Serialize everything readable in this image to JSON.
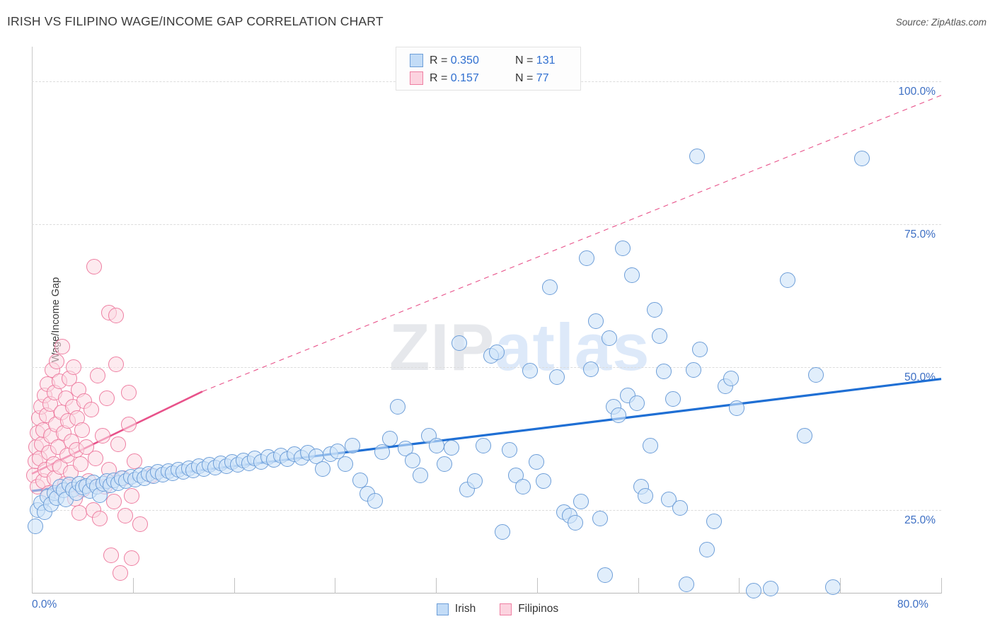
{
  "header": {
    "title": "IRISH VS FILIPINO WAGE/INCOME GAP CORRELATION CHART",
    "source": "Source: ZipAtlas.com"
  },
  "watermark": {
    "zip": "ZIP",
    "atlas": "atlas"
  },
  "stats": {
    "irish": {
      "r_label": "R = ",
      "r_value": "0.350",
      "n_label": "N = ",
      "n_value": "131"
    },
    "filipino": {
      "r_label": "R = ",
      "r_value": "0.157",
      "n_label": "N = ",
      "n_value": "77"
    }
  },
  "legend": {
    "irish_label": "Irish",
    "filipino_label": "Filipinos"
  },
  "chart_data": {
    "type": "scatter",
    "title": "IRISH VS FILIPINO WAGE/INCOME GAP CORRELATION CHART",
    "xlabel": "",
    "ylabel": "Wage/Income Gap",
    "xlim": [
      0,
      80
    ],
    "ylim": [
      10.5,
      106
    ],
    "grid": true,
    "legend_position": "bottom-center",
    "xticks": [
      0.0,
      80.0
    ],
    "xtick_labels": [
      "0.0%",
      "80.0%"
    ],
    "yticks": [
      25.0,
      50.0,
      75.0,
      100.0
    ],
    "ytick_labels": [
      "25.0%",
      "50.0%",
      "75.0%",
      "100.0%"
    ],
    "colors": {
      "irish_fill": "#cee3f8",
      "irish_stroke": "#6d9ed8",
      "filipino_fill": "#fbd8e2",
      "filipino_stroke": "#ee7fa2",
      "irish_trend": "#1f6fd4",
      "filipino_trend": "#e8528a",
      "tick_text": "#3d6fc4"
    },
    "series": [
      {
        "name": "Irish",
        "r": 0.35,
        "n": 131,
        "trend": {
          "style": "solid",
          "x0": 0.0,
          "y0": 28.3,
          "x1": 80.0,
          "y1": 47.9
        },
        "points": [
          [
            0.3,
            22.1
          ],
          [
            0.5,
            25.0
          ],
          [
            0.8,
            26.2
          ],
          [
            1.1,
            24.6
          ],
          [
            1.4,
            27.3
          ],
          [
            1.7,
            26.0
          ],
          [
            2.0,
            28.0
          ],
          [
            2.2,
            27.1
          ],
          [
            2.5,
            29.0
          ],
          [
            2.8,
            28.4
          ],
          [
            3.0,
            26.8
          ],
          [
            3.3,
            29.4
          ],
          [
            3.6,
            28.6
          ],
          [
            3.9,
            27.9
          ],
          [
            4.2,
            29.6
          ],
          [
            4.5,
            28.9
          ],
          [
            4.8,
            29.2
          ],
          [
            5.1,
            28.3
          ],
          [
            5.4,
            29.8
          ],
          [
            5.7,
            29.1
          ],
          [
            6.0,
            27.6
          ],
          [
            6.3,
            29.5
          ],
          [
            6.6,
            30.0
          ],
          [
            6.9,
            29.3
          ],
          [
            7.2,
            30.2
          ],
          [
            7.6,
            29.7
          ],
          [
            7.9,
            30.5
          ],
          [
            8.3,
            30.1
          ],
          [
            8.7,
            30.8
          ],
          [
            9.1,
            30.3
          ],
          [
            9.5,
            31.0
          ],
          [
            9.9,
            30.6
          ],
          [
            10.3,
            31.3
          ],
          [
            10.7,
            30.9
          ],
          [
            11.1,
            31.6
          ],
          [
            11.5,
            31.1
          ],
          [
            12.0,
            31.8
          ],
          [
            12.4,
            31.4
          ],
          [
            12.9,
            32.0
          ],
          [
            13.3,
            31.6
          ],
          [
            13.8,
            32.3
          ],
          [
            14.2,
            31.9
          ],
          [
            14.7,
            32.6
          ],
          [
            15.1,
            32.1
          ],
          [
            15.6,
            32.9
          ],
          [
            16.1,
            32.4
          ],
          [
            16.6,
            33.1
          ],
          [
            17.1,
            32.7
          ],
          [
            17.6,
            33.4
          ],
          [
            18.1,
            32.9
          ],
          [
            18.6,
            33.6
          ],
          [
            19.1,
            33.1
          ],
          [
            19.6,
            34.0
          ],
          [
            20.2,
            33.4
          ],
          [
            20.8,
            34.2
          ],
          [
            21.3,
            33.7
          ],
          [
            21.9,
            34.5
          ],
          [
            22.5,
            33.9
          ],
          [
            23.1,
            34.7
          ],
          [
            23.7,
            34.1
          ],
          [
            24.3,
            35.0
          ],
          [
            25.0,
            34.4
          ],
          [
            25.6,
            32.1
          ],
          [
            26.3,
            34.8
          ],
          [
            26.9,
            35.3
          ],
          [
            27.6,
            33.0
          ],
          [
            28.2,
            36.2
          ],
          [
            28.9,
            30.2
          ],
          [
            29.5,
            27.8
          ],
          [
            30.2,
            26.6
          ],
          [
            30.8,
            35.1
          ],
          [
            31.5,
            37.5
          ],
          [
            32.2,
            43.0
          ],
          [
            32.9,
            35.7
          ],
          [
            33.5,
            33.6
          ],
          [
            34.2,
            31.0
          ],
          [
            34.9,
            38.0
          ],
          [
            35.6,
            36.2
          ],
          [
            36.3,
            33.0
          ],
          [
            36.9,
            35.9
          ],
          [
            37.6,
            54.2
          ],
          [
            38.3,
            28.6
          ],
          [
            39.0,
            30.0
          ],
          [
            39.7,
            36.2
          ],
          [
            40.4,
            52.0
          ],
          [
            40.9,
            52.6
          ],
          [
            41.4,
            21.2
          ],
          [
            42.0,
            35.5
          ],
          [
            42.6,
            31.0
          ],
          [
            43.2,
            29.0
          ],
          [
            43.8,
            49.4
          ],
          [
            44.4,
            33.4
          ],
          [
            45.0,
            30.1
          ],
          [
            45.6,
            64.0
          ],
          [
            46.2,
            48.2
          ],
          [
            46.8,
            24.6
          ],
          [
            47.3,
            24.0
          ],
          [
            47.8,
            22.8
          ],
          [
            48.3,
            26.5
          ],
          [
            48.8,
            69.0
          ],
          [
            49.2,
            49.6
          ],
          [
            49.6,
            58.0
          ],
          [
            50.0,
            23.5
          ],
          [
            50.4,
            13.6
          ],
          [
            50.8,
            55.0
          ],
          [
            51.2,
            43.0
          ],
          [
            51.6,
            41.5
          ],
          [
            52.0,
            70.8
          ],
          [
            52.4,
            45.0
          ],
          [
            52.8,
            66.0
          ],
          [
            53.2,
            43.6
          ],
          [
            53.6,
            29.0
          ],
          [
            54.0,
            27.4
          ],
          [
            54.4,
            36.2
          ],
          [
            54.8,
            60.0
          ],
          [
            55.2,
            55.4
          ],
          [
            55.6,
            49.2
          ],
          [
            56.0,
            26.8
          ],
          [
            56.4,
            44.4
          ],
          [
            57.0,
            25.4
          ],
          [
            57.6,
            12.0
          ],
          [
            58.2,
            49.5
          ],
          [
            58.8,
            53.0
          ],
          [
            59.4,
            18.0
          ],
          [
            60.0,
            23.0
          ],
          [
            61.0,
            46.6
          ],
          [
            61.5,
            48.0
          ],
          [
            62.0,
            42.8
          ],
          [
            63.5,
            10.9
          ],
          [
            65.0,
            11.2
          ],
          [
            66.5,
            65.2
          ],
          [
            68.0,
            38.0
          ],
          [
            69.0,
            48.6
          ],
          [
            70.5,
            11.5
          ],
          [
            73.0,
            86.5
          ],
          [
            58.5,
            86.8
          ]
        ]
      },
      {
        "name": "Filipinos",
        "r": 0.157,
        "n": 77,
        "trend": {
          "style": "solid",
          "x0": 0.0,
          "y0": 31.3,
          "x1": 15.0,
          "y1": 45.7
        },
        "trend_extension": {
          "style": "dashed",
          "x0": 15.0,
          "y0": 45.7,
          "x1": 80.0,
          "y1": 97.5
        },
        "points": [
          [
            0.2,
            31.0
          ],
          [
            0.3,
            33.5
          ],
          [
            0.4,
            36.0
          ],
          [
            0.5,
            38.5
          ],
          [
            0.5,
            29.0
          ],
          [
            0.6,
            41.0
          ],
          [
            0.7,
            34.0
          ],
          [
            0.8,
            43.0
          ],
          [
            0.9,
            36.5
          ],
          [
            1.0,
            30.0
          ],
          [
            1.0,
            39.0
          ],
          [
            1.1,
            45.0
          ],
          [
            1.2,
            32.0
          ],
          [
            1.3,
            41.5
          ],
          [
            1.4,
            47.0
          ],
          [
            1.5,
            35.0
          ],
          [
            1.5,
            28.0
          ],
          [
            1.6,
            43.5
          ],
          [
            1.7,
            38.0
          ],
          [
            1.8,
            49.5
          ],
          [
            1.9,
            33.0
          ],
          [
            2.0,
            45.5
          ],
          [
            2.0,
            30.5
          ],
          [
            2.1,
            40.0
          ],
          [
            2.2,
            51.0
          ],
          [
            2.3,
            36.0
          ],
          [
            2.4,
            47.5
          ],
          [
            2.5,
            32.5
          ],
          [
            2.6,
            42.0
          ],
          [
            2.7,
            53.5
          ],
          [
            2.8,
            38.5
          ],
          [
            2.9,
            29.5
          ],
          [
            3.0,
            44.5
          ],
          [
            3.1,
            34.5
          ],
          [
            3.2,
            40.5
          ],
          [
            3.3,
            48.0
          ],
          [
            3.4,
            31.5
          ],
          [
            3.5,
            37.0
          ],
          [
            3.6,
            43.0
          ],
          [
            3.7,
            50.0
          ],
          [
            3.8,
            27.0
          ],
          [
            3.9,
            35.5
          ],
          [
            4.0,
            41.0
          ],
          [
            4.1,
            46.0
          ],
          [
            4.2,
            24.5
          ],
          [
            4.3,
            33.0
          ],
          [
            4.4,
            39.0
          ],
          [
            4.5,
            28.5
          ],
          [
            4.6,
            44.0
          ],
          [
            4.8,
            36.0
          ],
          [
            5.0,
            30.0
          ],
          [
            5.2,
            42.5
          ],
          [
            5.4,
            25.0
          ],
          [
            5.6,
            34.0
          ],
          [
            5.8,
            48.5
          ],
          [
            6.0,
            23.5
          ],
          [
            6.2,
            38.0
          ],
          [
            6.4,
            29.0
          ],
          [
            6.6,
            44.5
          ],
          [
            6.8,
            32.0
          ],
          [
            7.0,
            17.0
          ],
          [
            7.2,
            26.5
          ],
          [
            7.4,
            50.5
          ],
          [
            7.6,
            36.5
          ],
          [
            7.8,
            14.0
          ],
          [
            8.0,
            30.5
          ],
          [
            8.2,
            24.0
          ],
          [
            8.5,
            40.0
          ],
          [
            8.8,
            27.5
          ],
          [
            9.0,
            33.5
          ],
          [
            9.5,
            22.5
          ],
          [
            5.5,
            67.5
          ],
          [
            6.8,
            59.5
          ],
          [
            7.4,
            59.0
          ],
          [
            8.5,
            45.5
          ],
          [
            8.8,
            16.5
          ],
          [
            10.5,
            31.0
          ]
        ]
      }
    ]
  }
}
